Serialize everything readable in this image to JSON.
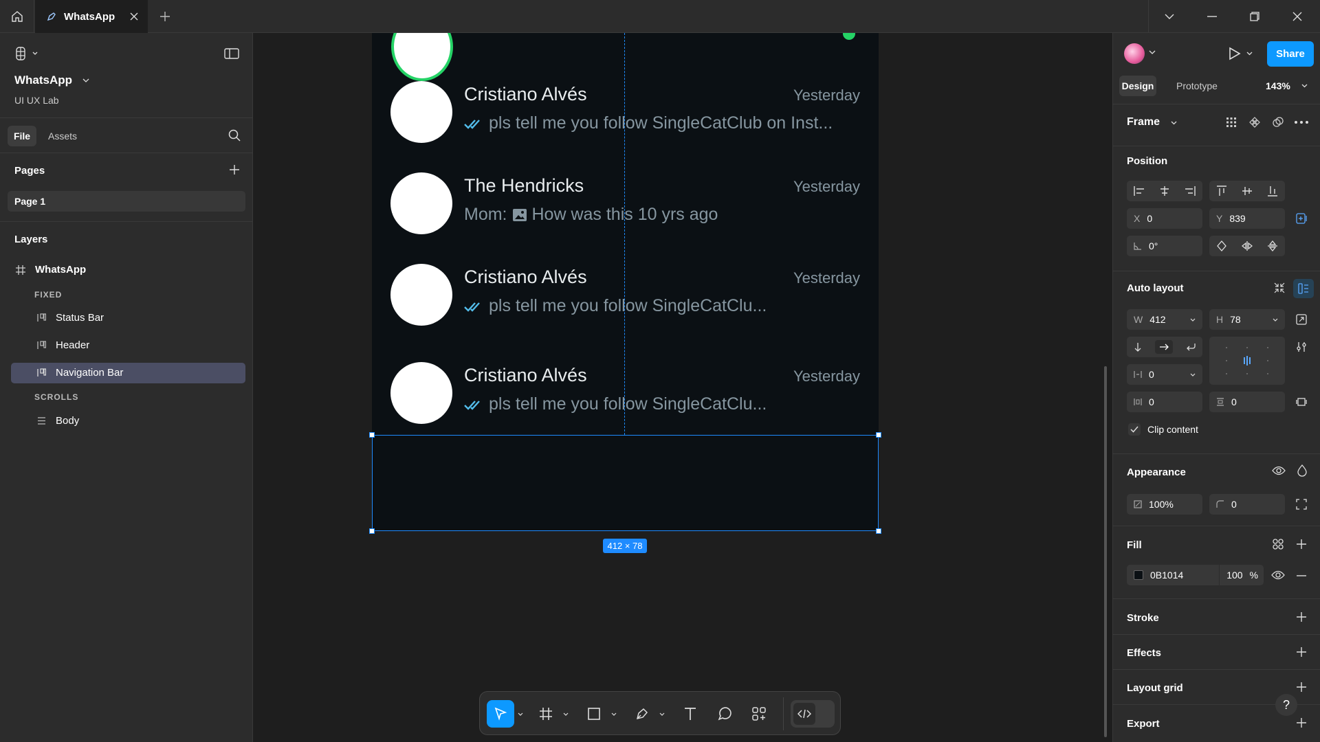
{
  "tab": {
    "title": "WhatsApp"
  },
  "file": {
    "name": "WhatsApp",
    "team": "UI UX Lab"
  },
  "left_tabs": {
    "file": "File",
    "assets": "Assets"
  },
  "pages": {
    "heading": "Pages",
    "items": [
      "Page 1"
    ]
  },
  "layers": {
    "heading": "Layers",
    "root": "WhatsApp",
    "fixed_label": "FIXED",
    "fixed": [
      "Status Bar",
      "Header",
      "Navigation Bar"
    ],
    "scrolls_label": "SCROLLS",
    "scrolls": [
      "Body"
    ]
  },
  "chats": [
    {
      "name": "Cristiano Alvés",
      "time": "Yesterday",
      "msg": "pls tell me you follow SingleCatClub on Inst...",
      "read": true,
      "photo": false
    },
    {
      "name": "The Hendricks",
      "time": "Yesterday",
      "msg": "Mom: ",
      "msg2": "How was this 10 yrs ago",
      "read": false,
      "photo": true
    },
    {
      "name": "Cristiano Alvés",
      "time": "Yesterday",
      "msg": "pls tell me you follow SingleCatClu...",
      "read": true,
      "photo": false
    },
    {
      "name": "Cristiano Alvés",
      "time": "Yesterday",
      "msg": "pls tell me you follow SingleCatClu...",
      "read": true,
      "photo": false
    }
  ],
  "selection": {
    "dims": "412 × 78"
  },
  "right": {
    "share": "Share",
    "tabs": {
      "design": "Design",
      "prototype": "Prototype"
    },
    "zoom": "143%",
    "frame_label": "Frame",
    "position": {
      "heading": "Position",
      "x_label": "X",
      "x": "0",
      "y_label": "Y",
      "y": "839",
      "rotation": "0°"
    },
    "auto_layout": {
      "heading": "Auto layout",
      "w_label": "W",
      "w": "412",
      "h_label": "H",
      "h": "78",
      "gap": "0",
      "pad_h": "0",
      "pad_v": "0",
      "clip": "Clip content"
    },
    "appearance": {
      "heading": "Appearance",
      "opacity": "100%",
      "radius": "0"
    },
    "fill": {
      "heading": "Fill",
      "hex": "0B1014",
      "opacity": "100",
      "pct": "%",
      "swatch": "#0B1014"
    },
    "stroke": "Stroke",
    "effects": "Effects",
    "layout_grid": "Layout grid",
    "export": "Export",
    "help": "?"
  },
  "colors": {
    "accent": "#0d99ff",
    "selection": "#1e8bff",
    "read_ticks": "#53bdeb",
    "canvas_frame": "#0b1014"
  }
}
